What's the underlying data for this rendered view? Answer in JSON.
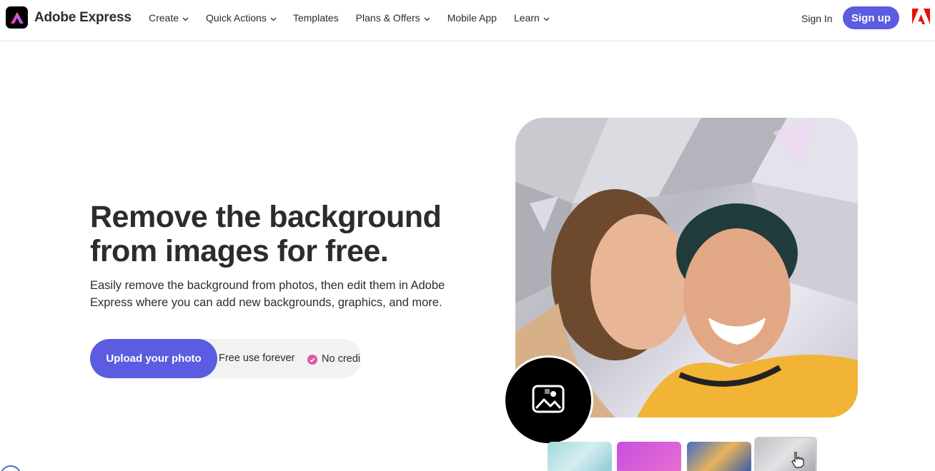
{
  "header": {
    "brand_name": "Adobe Express",
    "nav": [
      {
        "label": "Create",
        "has_menu": true
      },
      {
        "label": "Quick Actions",
        "has_menu": true
      },
      {
        "label": "Templates",
        "has_menu": false
      },
      {
        "label": "Plans & Offers",
        "has_menu": true
      },
      {
        "label": "Mobile App",
        "has_menu": false
      },
      {
        "label": "Learn",
        "has_menu": true
      }
    ],
    "sign_in": "Sign In",
    "sign_up": "Sign up"
  },
  "hero": {
    "title": "Remove the background from images for free.",
    "subtitle": "Easily remove the background from photos, then edit them in Adobe Express where you can add new backgrounds, graphics, and more.",
    "cta_label": "Upload your photo",
    "feature_1": "Free use forever",
    "feature_2": "No credi"
  },
  "icons": {
    "brand_logo": "adobe-express-logo-icon",
    "adobe_mark": "adobe-logo-icon",
    "check": "check-circle-icon",
    "image_tool": "image-icon"
  },
  "colors": {
    "accent": "#5c5ce0",
    "check": "#d85ba3",
    "adobe_red": "#eb1000",
    "text": "#2c2c2c"
  }
}
